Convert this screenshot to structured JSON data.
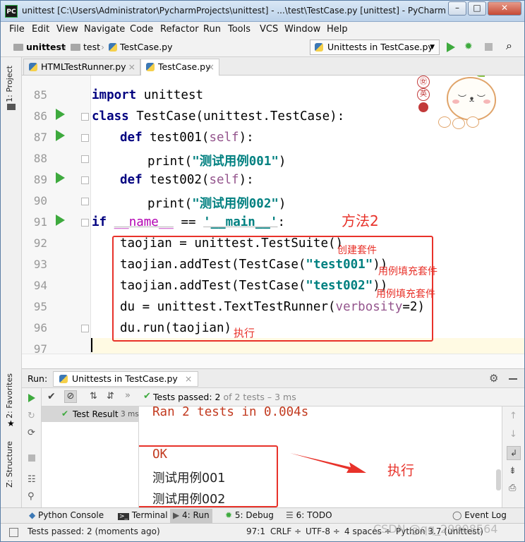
{
  "window": {
    "app_icon": "PC",
    "title": "unittest [C:\\Users\\Administrator\\PycharmProjects\\unittest] - ...\\test\\TestCase.py [unittest] - PyCharm (A...",
    "minimize": "–",
    "maximize": "□",
    "close": "✕"
  },
  "menu": [
    "File",
    "Edit",
    "View",
    "Navigate",
    "Code",
    "Refactor",
    "Run",
    "Tools",
    "VCS",
    "Window",
    "Help"
  ],
  "breadcrumb": [
    "unittest",
    "test",
    "TestCase.py"
  ],
  "run_config": "Unittests in TestCase.py",
  "editor_tabs": [
    {
      "label": "HTMLTestRunner.py",
      "active": false
    },
    {
      "label": "TestCase.py",
      "active": true
    }
  ],
  "left_tools": {
    "project": "1: Project",
    "favorites": "2: Favorites",
    "structure": "Z: Structure"
  },
  "line_numbers": [
    "85",
    "86",
    "87",
    "88",
    "89",
    "90",
    "91",
    "92",
    "93",
    "94",
    "95",
    "96",
    "97"
  ],
  "code": {
    "l85_kw": "import",
    "l85_rest": " unittest",
    "l86_kw": "class",
    "l86_name": " TestCase",
    "l86_rest": "(unittest.TestCase):",
    "l87_kw": "def",
    "l87_name": " test001(",
    "l87_param": "self",
    "l87_rest": "):",
    "l88_fn": "print(",
    "l88_str": "\"测试用例001\"",
    "l88_rest": ")",
    "l89_kw": "def",
    "l89_name": " test002(",
    "l89_param": "self",
    "l89_rest": "):",
    "l90_fn": "print(",
    "l90_str": "\"测试用例002\"",
    "l90_rest": ")",
    "l91_kw": "if",
    "l91_sp": " ",
    "l91_dunder": "__name__",
    "l91_op": " == ",
    "l91_str": "'__main__'",
    "l91_rest": ":",
    "l92": "taojian = unittest.TestSuite()",
    "l93_a": "taojian.addTest(TestCase(",
    "l93_str": "\"test001\"",
    "l93_b": "))",
    "l94_a": "taojian.addTest(TestCase(",
    "l94_str": "\"test002\"",
    "l94_b": "))",
    "l95_a": "du = unittest.TextTestRunner(",
    "l95_param": "verbosity",
    "l95_b": "=2)",
    "l96": "du.run(taojian)"
  },
  "annotations": {
    "method": "方法2",
    "create_suite": "创建套件",
    "fill_1": "用例填充套件",
    "fill_2": "用例填充套件",
    "run_code": "执行",
    "run_console": "执行"
  },
  "mascot": {
    "badge_1": "㊛",
    "badge_2": "英",
    "face": "︶ ᴥ ︶"
  },
  "run_panel": {
    "label": "Run:",
    "tab": "Unittests in TestCase.py",
    "status_prefix": "Tests passed: ",
    "status_count": "2",
    "status_suffix": " of 2 tests – 3 ms",
    "tree_item": "Test Result",
    "tree_time": "3 ms"
  },
  "console": [
    "Ran 2 tests in 0.004s",
    "OK",
    "测试用例001",
    "测试用例002"
  ],
  "bottom_tabs": [
    {
      "label": "Python Console"
    },
    {
      "label": "Terminal"
    },
    {
      "label": "4: Run"
    },
    {
      "label": "5: Debug"
    },
    {
      "label": "6: TODO"
    },
    {
      "label": "Event Log"
    }
  ],
  "status": {
    "message": "Tests passed: 2 (moments ago)",
    "position": "97:1",
    "line_sep": "CRLF ÷",
    "encoding": "UTF-8 ÷",
    "indent": "4 spaces ÷",
    "interpreter": "Python 3.7 (unittest)"
  },
  "watermark": "CSDN @qq_29908564",
  "colors": {
    "accent_red": "#e8322a",
    "run_green": "#3eaa3e",
    "keyword": "#000080",
    "string": "#008080"
  }
}
